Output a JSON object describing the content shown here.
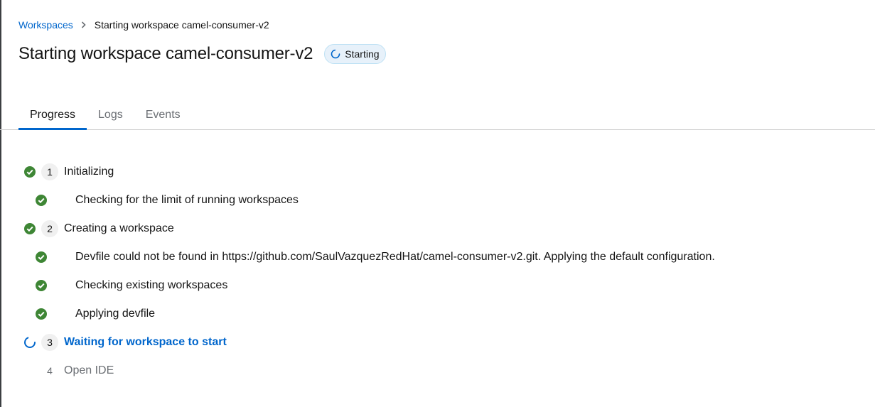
{
  "breadcrumb": {
    "root": "Workspaces",
    "current": "Starting workspace camel-consumer-v2"
  },
  "page": {
    "title": "Starting workspace camel-consumer-v2",
    "status_badge": "Starting"
  },
  "tabs": [
    {
      "label": "Progress",
      "active": true
    },
    {
      "label": "Logs",
      "active": false
    },
    {
      "label": "Events",
      "active": false
    }
  ],
  "progress": {
    "steps": [
      {
        "number": "1",
        "label": "Initializing",
        "state": "done",
        "substeps": [
          {
            "label": "Checking for the limit of running workspaces",
            "state": "done"
          }
        ]
      },
      {
        "number": "2",
        "label": "Creating a workspace",
        "state": "done",
        "substeps": [
          {
            "label": "Devfile could not be found in https://github.com/SaulVazquezRedHat/camel-consumer-v2.git. Applying the default configuration.",
            "state": "done"
          },
          {
            "label": "Checking existing workspaces",
            "state": "done"
          },
          {
            "label": "Applying devfile",
            "state": "done"
          }
        ]
      },
      {
        "number": "3",
        "label": "Waiting for workspace to start",
        "state": "in-progress"
      },
      {
        "number": "4",
        "label": "Open IDE",
        "state": "pending"
      }
    ]
  },
  "colors": {
    "success": "#3e8635",
    "link": "#0066cc",
    "muted": "#6a6e73"
  },
  "icons": {
    "done": "check-circle-icon",
    "in_progress": "spinner-icon",
    "breadcrumb_separator": "chevron-right-icon"
  }
}
